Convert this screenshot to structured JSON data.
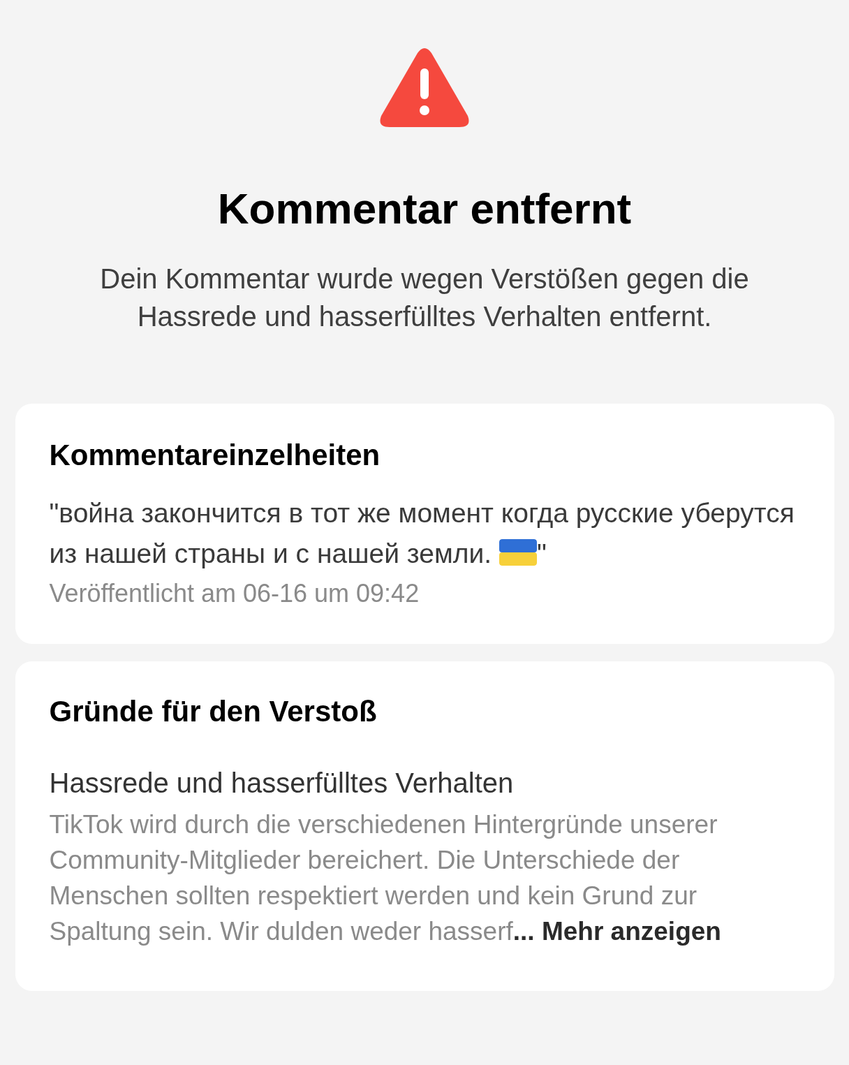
{
  "header": {
    "title": "Kommentar entfernt",
    "subtitle": "Dein Kommentar wurde wegen Verstößen gegen die Hassrede und hasserfülltes Verhalten entfernt."
  },
  "comment_card": {
    "heading": "Kommentareinzelheiten",
    "text_before_flag": "\"война закончится в тот же момент когда русские уберутся из нашей страны и с нашей земли.",
    "text_after_flag": "\"",
    "posted": "Veröffentlicht am 06-16 um 09:42"
  },
  "reasons_card": {
    "heading": "Gründe für den Verstoß",
    "reason": "Hassrede und hasserfülltes Verhalten",
    "description": "TikTok wird durch die verschiedenen Hintergründe unserer Community-Mitglieder bereichert. Die Unterschiede der Menschen sollten respektiert werden und kein Grund zur Spaltung sein. Wir dulden weder hasserf",
    "more_link": "... Mehr anzeigen"
  }
}
